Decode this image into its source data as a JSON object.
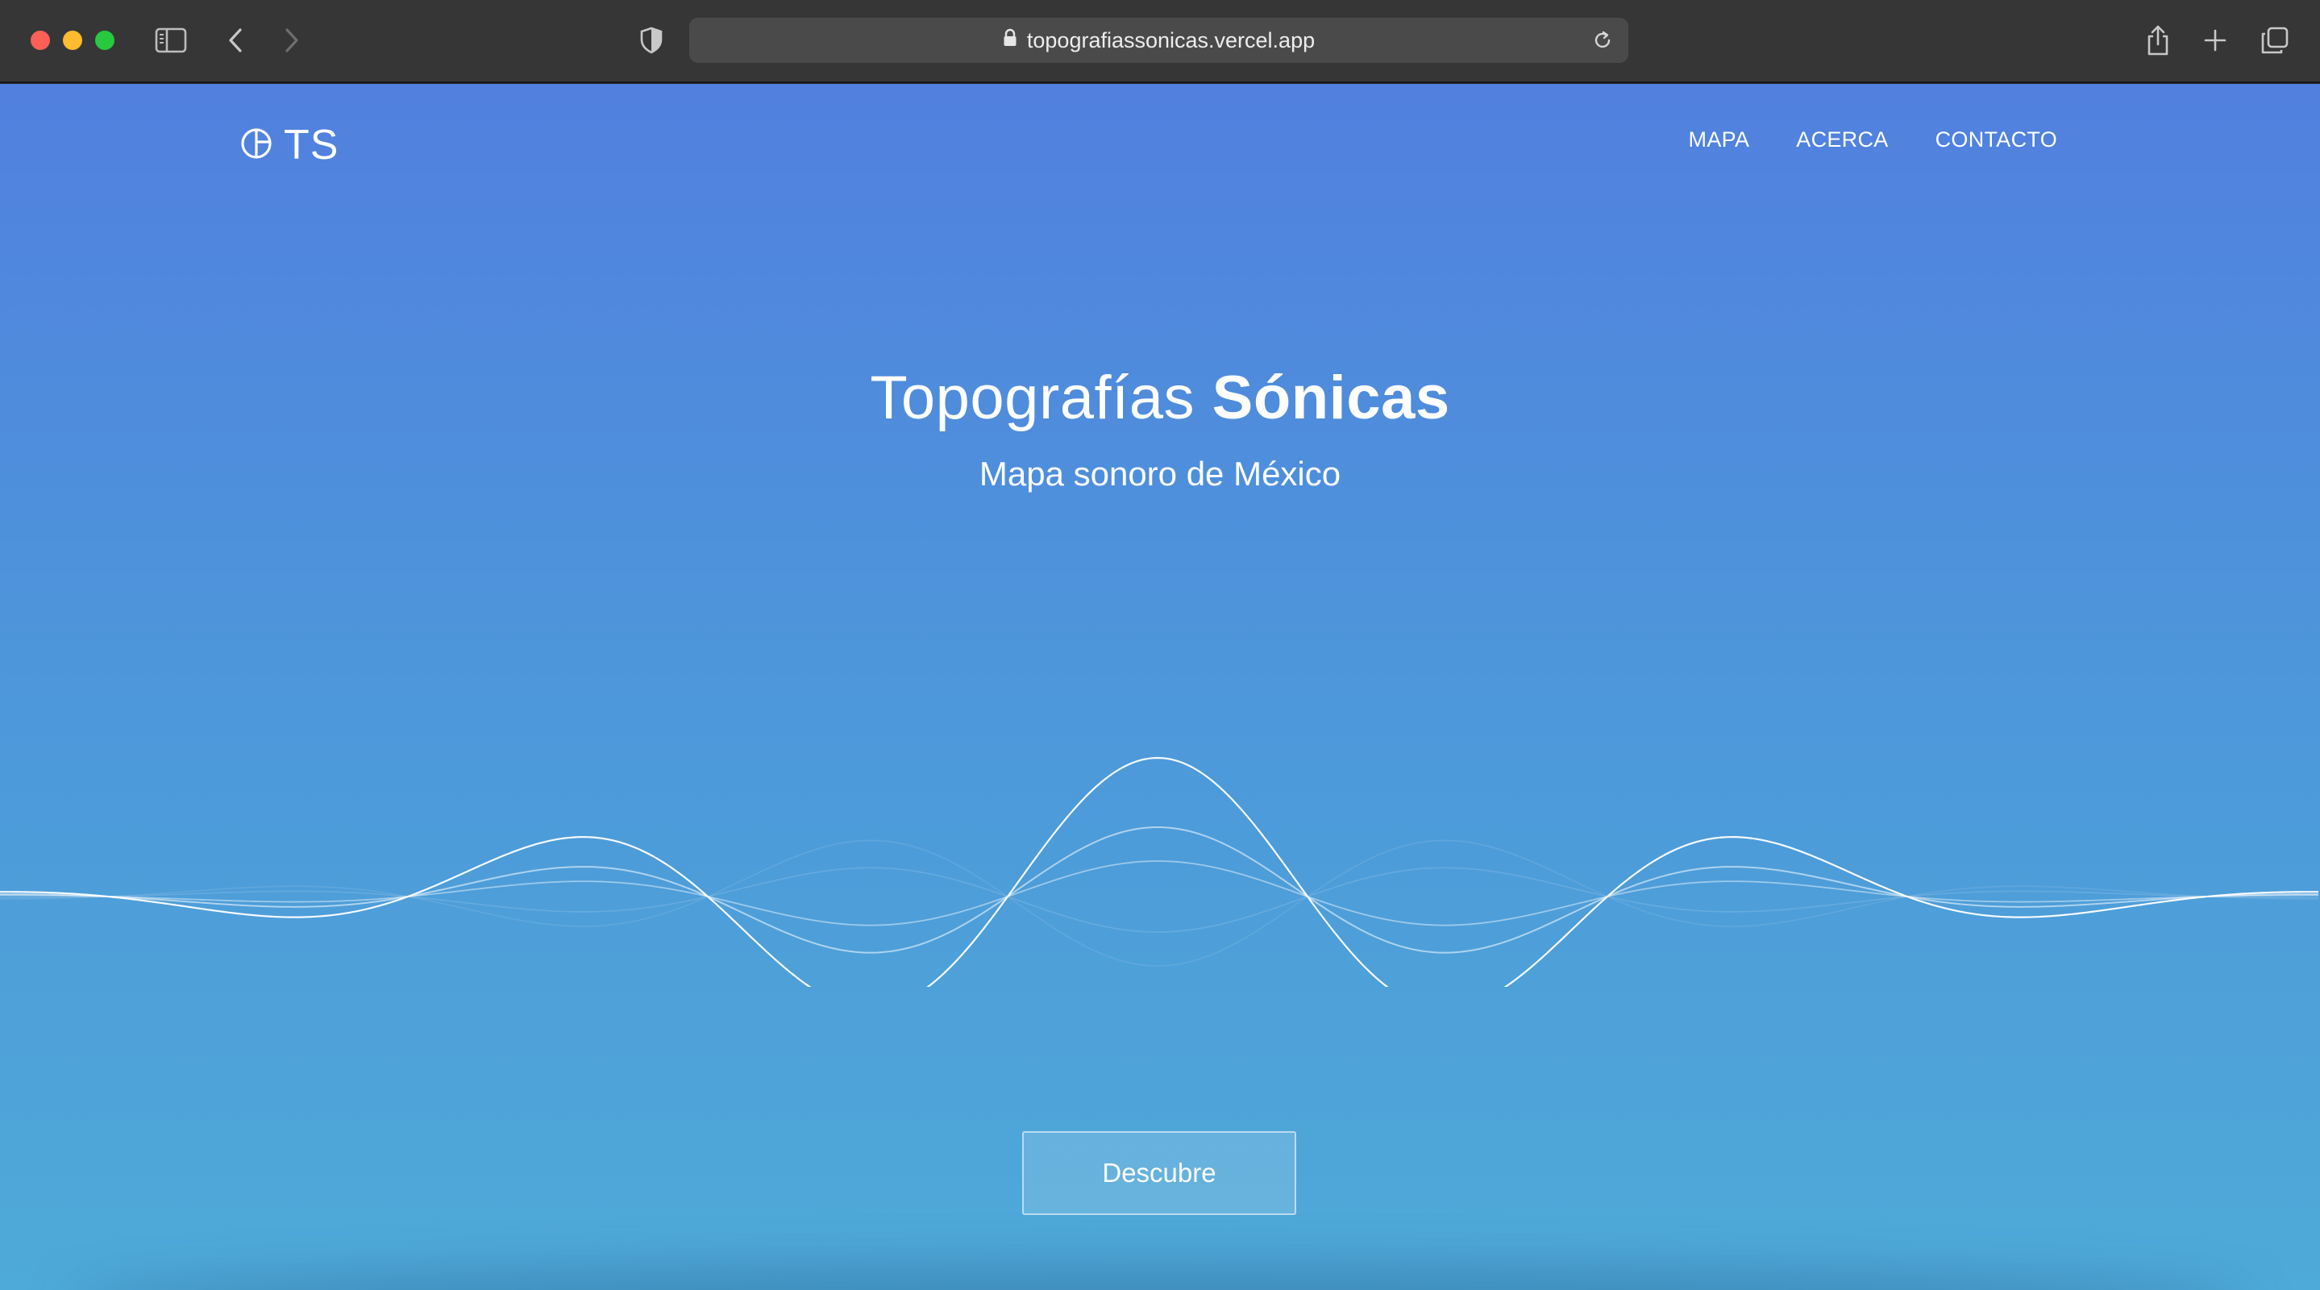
{
  "browser": {
    "url": "topografiassonicas.vercel.app",
    "traffic_colors": {
      "close": "#fe5f57",
      "minimize": "#febc2e",
      "zoom": "#28c840"
    }
  },
  "site": {
    "logo_text": "TS",
    "nav": [
      {
        "label": "MAPA"
      },
      {
        "label": "ACERCA"
      },
      {
        "label": "CONTACTO"
      }
    ],
    "hero": {
      "title_regular": "Topografías ",
      "title_bold": "Sónicas",
      "subtitle": "Mapa sonoro de México"
    },
    "cta_label": "Descubre"
  },
  "colors": {
    "gradient_top": "#5180df",
    "gradient_mid": "#4d97da",
    "gradient_bottom": "#4eaad8",
    "text": "#ffffff"
  }
}
